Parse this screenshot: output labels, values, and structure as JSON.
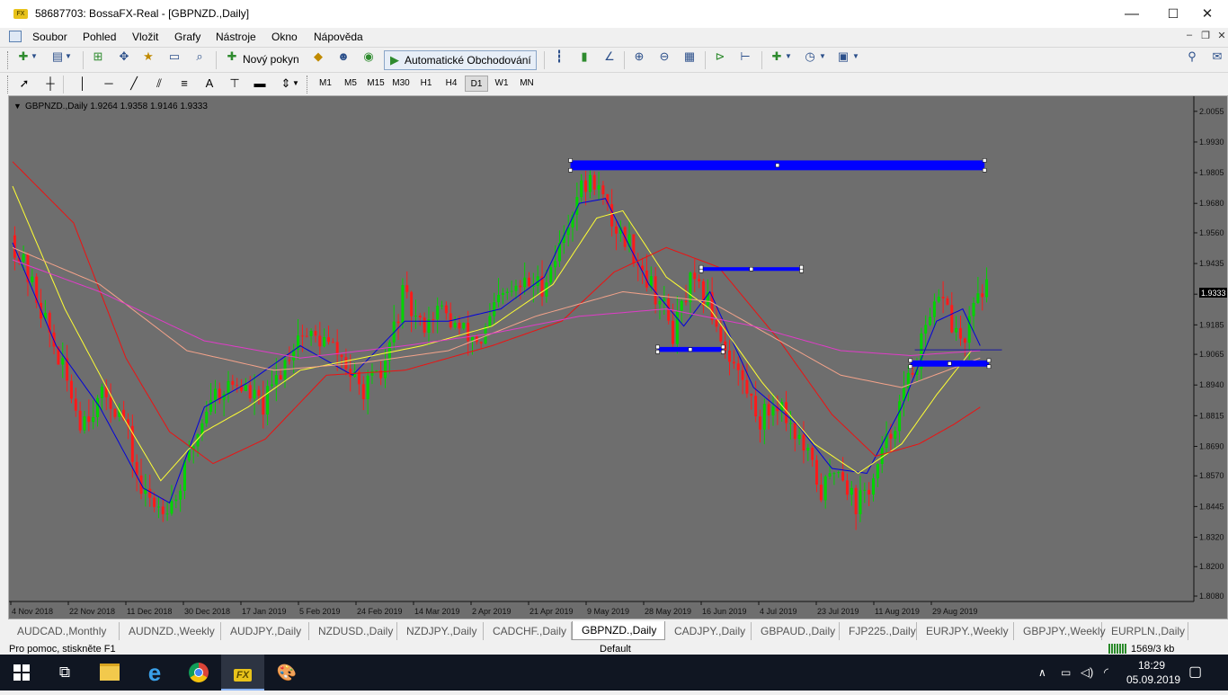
{
  "window": {
    "title": "58687703: BossaFX-Real - [GBPNZD.,Daily]",
    "app_icon_text": "FX",
    "minimize": "—",
    "maximize": "☐",
    "close": "✕"
  },
  "menu": {
    "items": [
      "Soubor",
      "Pohled",
      "Vložit",
      "Grafy",
      "Nástroje",
      "Okno",
      "Nápověda"
    ],
    "mdi_minimize": "–",
    "mdi_restore": "❐",
    "mdi_close": "✕"
  },
  "toolbar1": {
    "new_order_label": "Nový pokyn",
    "autotrading_label": "Automatické Obchodování"
  },
  "toolbar2": {
    "line_tools": [
      "cursor-icon",
      "crosshair-icon",
      "vertical-line-icon",
      "horizontal-line-icon",
      "trendline-icon",
      "channel-icon",
      "fibonacci-icon",
      "text-icon",
      "text-label-icon",
      "rectangle-icon",
      "arrows-icon"
    ],
    "text_tool": "A",
    "timeframes": [
      "M1",
      "M5",
      "M15",
      "M30",
      "H1",
      "H4",
      "D1",
      "W1",
      "MN"
    ],
    "active_timeframe": "D1"
  },
  "chart": {
    "header": "GBPNZD.,Daily  1.9264 1.9358 1.9146 1.9333",
    "current_price": "1.9333",
    "background": "#6e6e6e",
    "bull_color": "#00d400",
    "bear_color": "#ff1a1a",
    "zone_color": "#0000ff"
  },
  "chart_data": {
    "type": "candlestick",
    "symbol": "GBPNZD.",
    "timeframe": "Daily",
    "ohlc_last": {
      "open": 1.9264,
      "high": 1.9358,
      "low": 1.9146,
      "close": 1.9333
    },
    "y_ticks": [
      "2.0055",
      "1.9930",
      "1.9805",
      "1.9680",
      "1.9560",
      "1.9435",
      "1.9310",
      "1.9185",
      "1.9065",
      "1.8940",
      "1.8815",
      "1.8690",
      "1.8570",
      "1.8445",
      "1.8320",
      "1.8200",
      "1.8080"
    ],
    "x_ticks": [
      "4 Nov 2018",
      "22 Nov 2018",
      "11 Dec 2018",
      "30 Dec 2018",
      "17 Jan 2019",
      "5 Feb 2019",
      "24 Feb 2019",
      "14 Mar 2019",
      "2 Apr 2019",
      "21 Apr 2019",
      "9 May 2019",
      "28 May 2019",
      "16 Jun 2019",
      "4 Jul 2019",
      "23 Jul 2019",
      "11 Aug 2019",
      "29 Aug 2019"
    ],
    "ylim": [
      1.808,
      2.008
    ],
    "price_path": [
      [
        0,
        1.955
      ],
      [
        6,
        1.93
      ],
      [
        12,
        1.9
      ],
      [
        16,
        1.88
      ],
      [
        22,
        1.89
      ],
      [
        26,
        1.88
      ],
      [
        30,
        1.85
      ],
      [
        34,
        1.845
      ],
      [
        38,
        1.848
      ],
      [
        42,
        1.87
      ],
      [
        46,
        1.89
      ],
      [
        52,
        1.895
      ],
      [
        58,
        1.885
      ],
      [
        62,
        1.9
      ],
      [
        66,
        1.915
      ],
      [
        72,
        1.912
      ],
      [
        76,
        1.905
      ],
      [
        80,
        1.892
      ],
      [
        85,
        1.897
      ],
      [
        90,
        1.93
      ],
      [
        94,
        1.918
      ],
      [
        98,
        1.925
      ],
      [
        104,
        1.915
      ],
      [
        108,
        1.912
      ],
      [
        112,
        1.928
      ],
      [
        118,
        1.935
      ],
      [
        122,
        1.935
      ],
      [
        126,
        1.95
      ],
      [
        130,
        1.972
      ],
      [
        134,
        1.978
      ],
      [
        138,
        1.96
      ],
      [
        142,
        1.952
      ],
      [
        146,
        1.938
      ],
      [
        150,
        1.925
      ],
      [
        152,
        1.915
      ],
      [
        156,
        1.935
      ],
      [
        160,
        1.928
      ],
      [
        164,
        1.91
      ],
      [
        168,
        1.895
      ],
      [
        172,
        1.88
      ],
      [
        176,
        1.888
      ],
      [
        180,
        1.875
      ],
      [
        184,
        1.86
      ],
      [
        186,
        1.85
      ],
      [
        190,
        1.862
      ],
      [
        194,
        1.845
      ],
      [
        198,
        1.855
      ],
      [
        202,
        1.875
      ],
      [
        206,
        1.895
      ],
      [
        210,
        1.915
      ],
      [
        214,
        1.932
      ],
      [
        216,
        1.918
      ],
      [
        219,
        1.91
      ],
      [
        222,
        1.933
      ]
    ],
    "ma_levels": {
      "blue_fast": [
        [
          0,
          1.952
        ],
        [
          10,
          1.91
        ],
        [
          20,
          1.885
        ],
        [
          30,
          1.852
        ],
        [
          36,
          1.846
        ],
        [
          44,
          1.885
        ],
        [
          54,
          1.895
        ],
        [
          66,
          1.91
        ],
        [
          78,
          1.898
        ],
        [
          90,
          1.92
        ],
        [
          100,
          1.92
        ],
        [
          112,
          1.925
        ],
        [
          122,
          1.938
        ],
        [
          130,
          1.968
        ],
        [
          136,
          1.97
        ],
        [
          146,
          1.935
        ],
        [
          154,
          1.918
        ],
        [
          160,
          1.932
        ],
        [
          170,
          1.893
        ],
        [
          180,
          1.878
        ],
        [
          188,
          1.86
        ],
        [
          196,
          1.858
        ],
        [
          204,
          1.885
        ],
        [
          212,
          1.92
        ],
        [
          218,
          1.925
        ],
        [
          222,
          1.91
        ]
      ],
      "yellow": [
        [
          0,
          1.975
        ],
        [
          12,
          1.925
        ],
        [
          24,
          1.885
        ],
        [
          34,
          1.855
        ],
        [
          44,
          1.875
        ],
        [
          54,
          1.885
        ],
        [
          66,
          1.9
        ],
        [
          80,
          1.905
        ],
        [
          94,
          1.91
        ],
        [
          110,
          1.918
        ],
        [
          124,
          1.935
        ],
        [
          134,
          1.962
        ],
        [
          140,
          1.965
        ],
        [
          150,
          1.938
        ],
        [
          160,
          1.925
        ],
        [
          172,
          1.895
        ],
        [
          184,
          1.87
        ],
        [
          194,
          1.858
        ],
        [
          204,
          1.87
        ],
        [
          212,
          1.89
        ],
        [
          220,
          1.908
        ]
      ],
      "red": [
        [
          0,
          1.985
        ],
        [
          14,
          1.96
        ],
        [
          26,
          1.905
        ],
        [
          36,
          1.875
        ],
        [
          46,
          1.862
        ],
        [
          58,
          1.872
        ],
        [
          72,
          1.898
        ],
        [
          90,
          1.9
        ],
        [
          110,
          1.91
        ],
        [
          126,
          1.92
        ],
        [
          138,
          1.94
        ],
        [
          150,
          1.95
        ],
        [
          162,
          1.942
        ],
        [
          176,
          1.912
        ],
        [
          188,
          1.882
        ],
        [
          198,
          1.865
        ],
        [
          208,
          1.87
        ],
        [
          216,
          1.878
        ],
        [
          222,
          1.885
        ]
      ],
      "salmon": [
        [
          0,
          1.95
        ],
        [
          20,
          1.935
        ],
        [
          40,
          1.908
        ],
        [
          60,
          1.9
        ],
        [
          80,
          1.903
        ],
        [
          100,
          1.908
        ],
        [
          120,
          1.922
        ],
        [
          140,
          1.932
        ],
        [
          160,
          1.928
        ],
        [
          176,
          1.912
        ],
        [
          190,
          1.898
        ],
        [
          204,
          1.893
        ],
        [
          222,
          1.905
        ]
      ],
      "magenta": [
        [
          0,
          1.945
        ],
        [
          20,
          1.932
        ],
        [
          44,
          1.912
        ],
        [
          66,
          1.905
        ],
        [
          90,
          1.91
        ],
        [
          110,
          1.915
        ],
        [
          130,
          1.922
        ],
        [
          150,
          1.925
        ],
        [
          170,
          1.918
        ],
        [
          190,
          1.908
        ],
        [
          206,
          1.906
        ],
        [
          222,
          1.908
        ]
      ]
    },
    "zones": [
      {
        "from": 128,
        "to": 223,
        "price_low": 1.9815,
        "price_high": 1.9855
      },
      {
        "from": 158,
        "to": 181,
        "price_low": 1.9405,
        "price_high": 1.942
      },
      {
        "from": 148,
        "to": 163,
        "price_low": 1.9075,
        "price_high": 1.9095
      },
      {
        "from": 206,
        "to": 224,
        "price_low": 1.9015,
        "price_high": 1.904
      }
    ]
  },
  "tabs": [
    "AUDCAD.,Monthly",
    "AUDNZD.,Weekly",
    "AUDJPY.,Daily",
    "NZDUSD.,Daily",
    "NZDJPY.,Daily",
    "CADCHF.,Daily",
    "GBPNZD.,Daily",
    "CADJPY.,Daily",
    "GBPAUD.,Daily",
    "FJP225.,Daily",
    "EURJPY.,Weekly",
    "GBPJPY.,Weekly",
    "EURPLN.,Daily"
  ],
  "active_tab": "GBPNZD.,Daily",
  "status": {
    "help": "Pro pomoc, stiskněte F1",
    "profile": "Default",
    "traffic": "1569/3 kb"
  },
  "taskbar": {
    "time": "18:29",
    "date": "05.09.2019",
    "app_fx": "FX"
  }
}
